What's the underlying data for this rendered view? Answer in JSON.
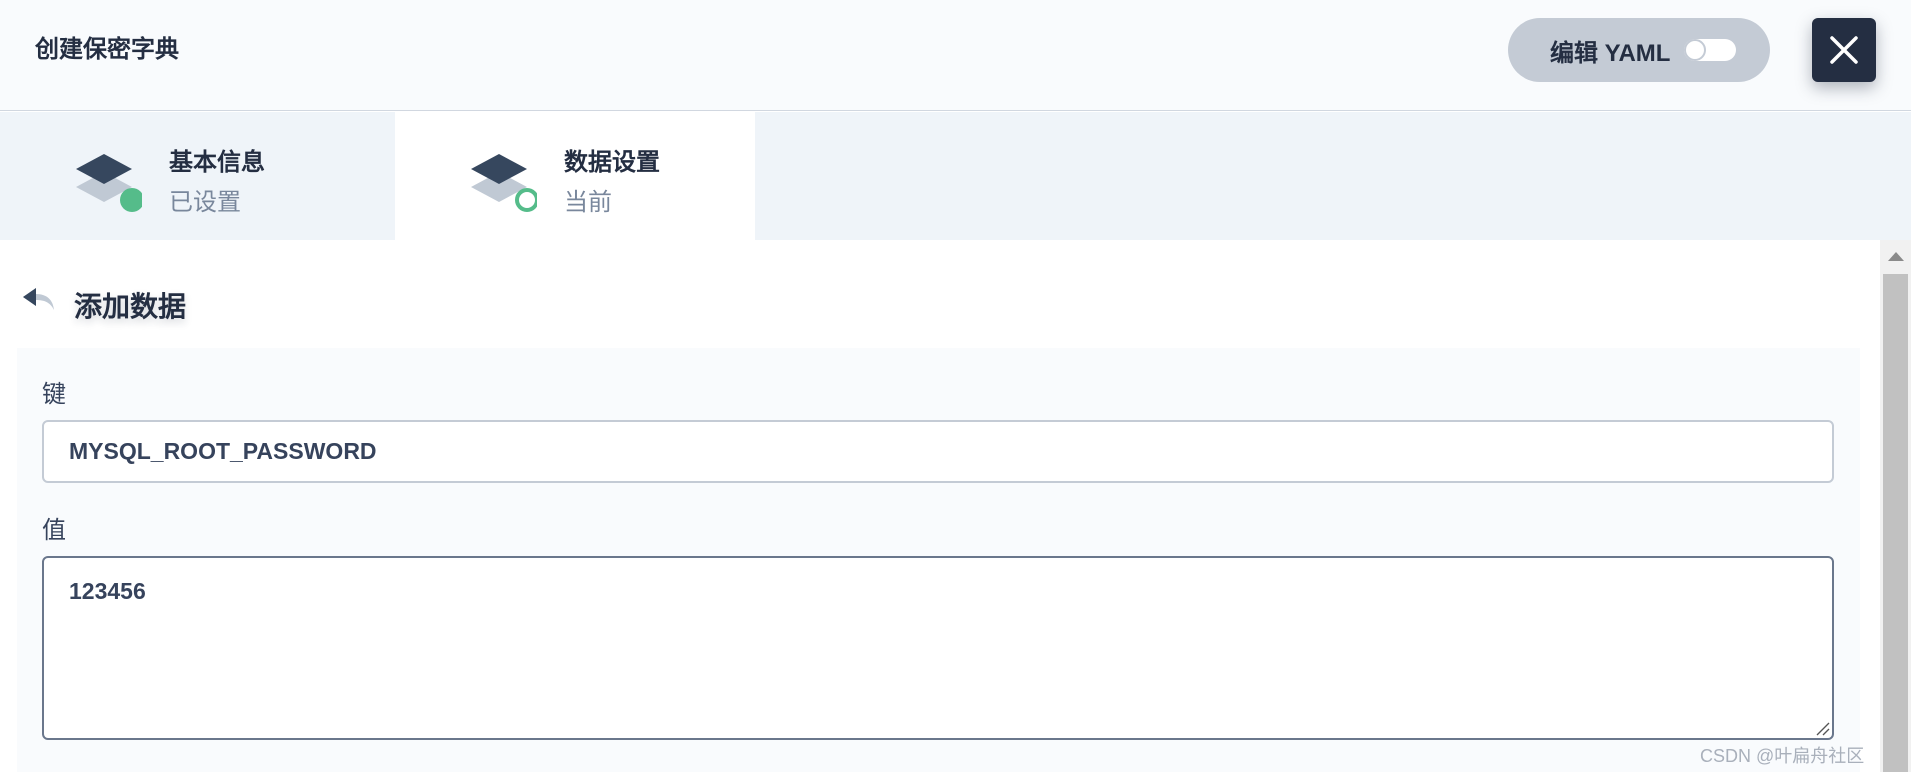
{
  "header": {
    "title": "创建保密字典",
    "yaml_label": "编辑 YAML"
  },
  "steps": [
    {
      "title": "基本信息",
      "status": "已设置"
    },
    {
      "title": "数据设置",
      "status": "当前"
    }
  ],
  "form": {
    "section_title": "添加数据",
    "key_label": "键",
    "key_value": "MYSQL_ROOT_PASSWORD",
    "value_label": "值",
    "value_value": "123456"
  },
  "watermark": "CSDN @叶扁舟社区",
  "colors": {
    "primary_dark": "#242e42",
    "success_green": "#55bc8a",
    "muted_text": "#79879c"
  }
}
